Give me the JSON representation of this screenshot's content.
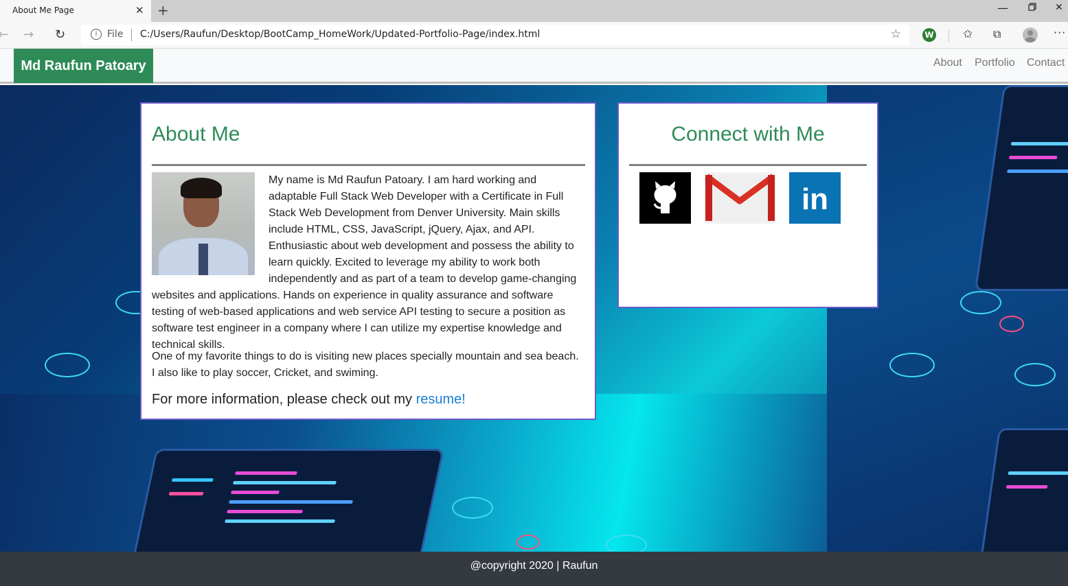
{
  "browser": {
    "tab_title": "About Me Page",
    "tab_close": "✕",
    "new_tab": "+",
    "file_label": "File",
    "url": "C:/Users/Raufun/Desktop/BootCamp_HomeWork/Updated-Portfolio-Page/index.html",
    "extension_letter": "W",
    "icons": {
      "back": "arrow-left-icon",
      "forward": "arrow-right-icon",
      "reload": "reload-icon",
      "info": "info-icon",
      "favorite": "star-icon",
      "favorites": "favorites-icon",
      "collections": "collections-icon",
      "profile": "profile-icon",
      "more": "more-icon"
    }
  },
  "navbar": {
    "brand": "Md Raufun Patoary",
    "links": [
      "About",
      "Portfolio",
      "Contact"
    ]
  },
  "about": {
    "title": "About Me",
    "paragraph1": "My name is Md Raufun Patoary. I am hard working and adaptable Full Stack Web Developer with a Certificate in Full Stack Web Development from Denver University. Main skills include HTML, CSS, JavaScript, jQuery, Ajax, and API. Enthusiastic about web development and possess the ability to learn quickly. Excited to leverage my ability to work both independently and as part of a team to develop game-changing websites and applications. Hands on experience in quality assurance and software testing of web-based applications and web service API testing to secure a position as software test engineer in a company where I can utilize my expertise knowledge and technical skills.",
    "paragraph2": "One of my favorite things to do is visiting new places specially mountain and sea beach. I also like to play soccer, Cricket, and swiming.",
    "more_info": "For more information, please check out my",
    "resume_link": "resume!"
  },
  "connect": {
    "title": "Connect with Me",
    "icons": [
      "github-icon",
      "gmail-icon",
      "linkedin-icon"
    ],
    "linkedin_text": "in"
  },
  "footer": {
    "text": "@copyright 2020 | Raufun"
  },
  "colors": {
    "brand_green": "#2e8b57",
    "card_border": "#6a5acd",
    "footer_bg": "#343a40",
    "link_blue": "#1a7fd4"
  }
}
